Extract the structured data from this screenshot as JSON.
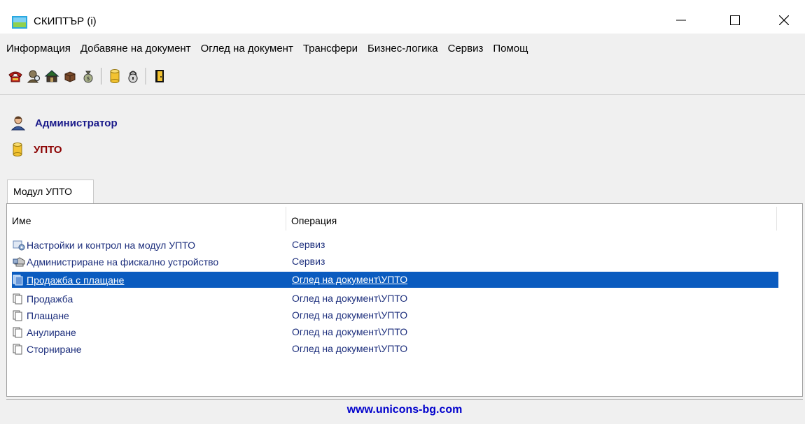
{
  "window": {
    "title": "СКИПТЪР (i)",
    "icon": "app-icon",
    "controls": [
      "minimize-icon",
      "maximize-icon",
      "close-icon"
    ]
  },
  "menu": {
    "items": [
      {
        "label": "Информация"
      },
      {
        "label": "Добавяне на документ"
      },
      {
        "label": "Оглед на документ"
      },
      {
        "label": "Трансфери"
      },
      {
        "label": "Бизнес-логика"
      },
      {
        "label": "Сервиз"
      },
      {
        "label": "Помощ"
      }
    ]
  },
  "toolbar": {
    "icons": [
      "phone-icon",
      "user-search-icon",
      "house-icon",
      "package-icon",
      "money-bag-icon",
      "database-icon",
      "lock-icon",
      "exit-door-icon"
    ]
  },
  "info": {
    "user": "Администратор",
    "database": "УПТО"
  },
  "tabs": [
    {
      "label": "Модул УПТО"
    }
  ],
  "list": {
    "columns": [
      "Име",
      "Операция"
    ],
    "rows": [
      {
        "icon": "settings-icon",
        "name": "Настройки и контрол на модул УПТО",
        "op": "Сервиз",
        "selected": false
      },
      {
        "icon": "printer-icon",
        "name": "Администриране на фискално устройство",
        "op": "Сервиз",
        "selected": false
      },
      {
        "icon": "document-filled-icon",
        "name": "Продажба с плащане",
        "op": "Оглед на документ\\УПТО",
        "selected": true
      },
      {
        "icon": "document-icon",
        "name": "Продажба",
        "op": "Оглед на документ\\УПТО",
        "selected": false
      },
      {
        "icon": "document-icon",
        "name": "Плащане",
        "op": "Оглед на документ\\УПТО",
        "selected": false
      },
      {
        "icon": "document-icon",
        "name": "Анулиране",
        "op": "Оглед на документ\\УПТО",
        "selected": false
      },
      {
        "icon": "document-icon",
        "name": "Сторниране",
        "op": "Оглед на документ\\УПТО",
        "selected": false
      }
    ]
  },
  "status": {
    "website": "www.unicons-bg.com"
  },
  "colors": {
    "selection": "#0a5bbf",
    "row_text": "#1c2e7c",
    "user_text": "#1a1a8a",
    "db_text": "#8b0000",
    "website": "#0000cc"
  }
}
